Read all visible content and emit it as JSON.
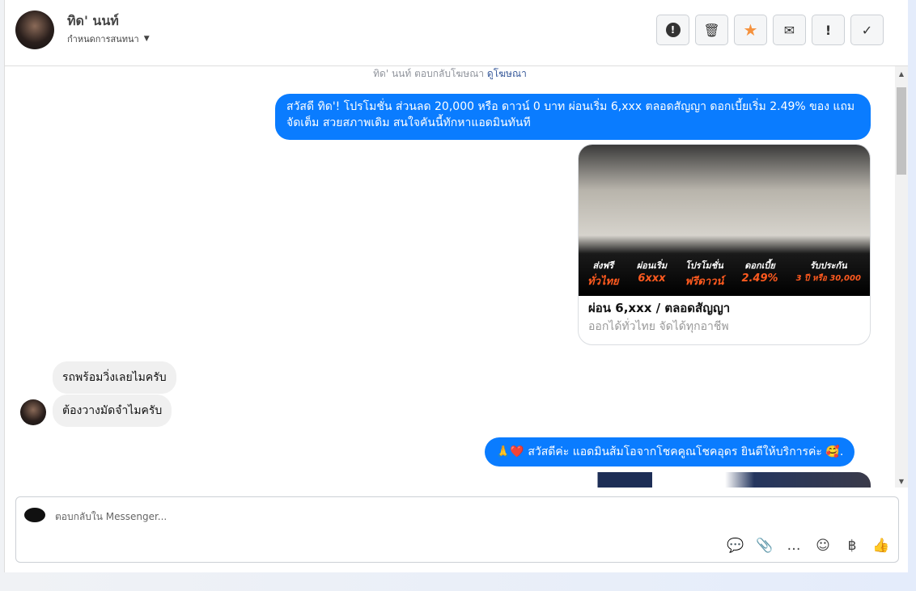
{
  "header": {
    "name": "ทิด' นนท์",
    "subtitle": "กำหนดการสนทนา"
  },
  "toolbar": [
    {
      "icon": "alert-circle-icon",
      "glyph": "⬤"
    },
    {
      "icon": "trash-icon",
      "glyph": "🗑"
    },
    {
      "icon": "star-icon",
      "glyph": "★"
    },
    {
      "icon": "mail-icon",
      "glyph": "✉"
    },
    {
      "icon": "exclamation-icon",
      "glyph": "!"
    },
    {
      "icon": "check-icon",
      "glyph": "✓"
    }
  ],
  "messages": {
    "system": "ทิด' นนท์ ตอบกลับโฆษณา",
    "system_link": "ดูโฆษณา",
    "ad_text": "สวัสดี ทิด'! โปรโมชั่น ส่วนลด 20,000 หรือ ดาวน์ 0 บาท ผ่อนเริ่ม 6,xxx ตลอดสัญญา ดอกเบี้ยเริ่ม 2.49% ของ แถมจัดเต็ม สวยสภาพเดิม สนใจคันนี้ทักหาแอดมินทันที",
    "card": {
      "title": "ผ่อน 6,xxx / ตลอดสัญญา",
      "subtitle": "ออกได้ทั่วไทย จัดได้ทุกอาชีพ",
      "banner": [
        {
          "top": "ส่งฟรี",
          "bottom": "ทั่วไทย"
        },
        {
          "top": "ผ่อนเริ่ม",
          "bottom": "6xxx"
        },
        {
          "top": "โปรโมชั่น",
          "bottom": "ฟรีดาวน์"
        },
        {
          "top": "ดอกเบี้ย",
          "bottom": "2.49%"
        },
        {
          "top": "รับประกัน",
          "bottom": "3 ปี หรือ 30,000"
        }
      ]
    },
    "in1": "รถพร้อมวิ่งเลยไมครับ",
    "in2": "ต้องวางมัดจำไมครับ",
    "out2": "🙏❤️ สวัสดีค่ะ แอดมินส้มโอจากโชคคูณโชคอุดร ยินดีให้บริการค่ะ 🥰."
  },
  "composer": {
    "placeholder": "ตอบกลับใน Messenger..."
  },
  "colors": {
    "accent": "#0a7cff",
    "orange": "#ff5a1f"
  }
}
